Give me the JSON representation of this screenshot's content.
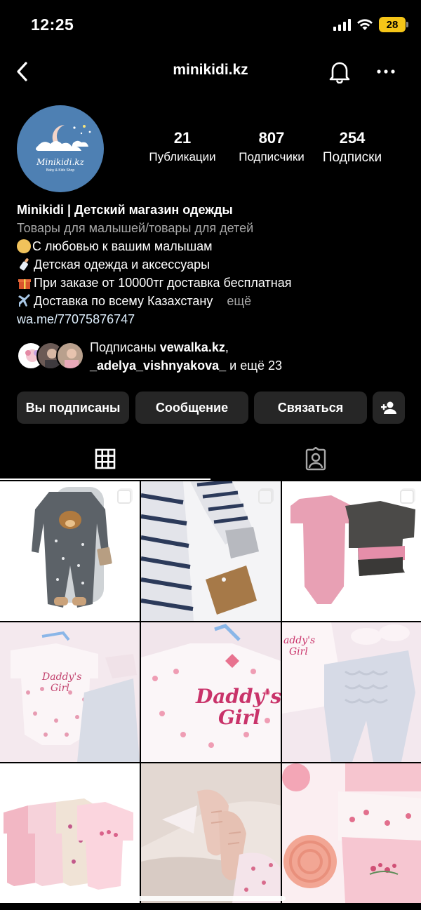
{
  "status_bar": {
    "time": "12:25",
    "battery": "28"
  },
  "nav": {
    "title": "minikidi.kz",
    "back_icon": "chevron-left-icon",
    "bell_icon": "bell-icon",
    "more_icon": "more-horizontal-icon"
  },
  "profile": {
    "avatar_logo": "Minikidi.kz",
    "avatar_sub": "Baby & Kids Shop",
    "stats": [
      {
        "num": "21",
        "label": "Публикации"
      },
      {
        "num": "807",
        "label": "Подписчики"
      },
      {
        "num": "254",
        "label": "Подписки"
      }
    ]
  },
  "bio": {
    "name": "Minikidi | Детский магазин одежды",
    "category": "Товары для малышей/товары для детей",
    "line1": "С любовью к вашим малышам",
    "line2": "Детская одежда и аксессуары",
    "line3": "При заказе от 10000тг доставка бесплатная",
    "line4": "Доставка по всему Казахстану",
    "more": "ещё",
    "link": "wa.me/77075876747"
  },
  "followed_by": {
    "prefix": "Подписаны",
    "user1": "vewalka.kz",
    "user2": "_adelya_vishnyakova_",
    "suffix": "и ещё 23"
  },
  "buttons": {
    "following": "Вы подписаны",
    "message": "Сообщение",
    "contact": "Связаться",
    "add_user_icon": "add-user-icon"
  },
  "tabs": {
    "grid_icon": "grid-icon",
    "tagged_icon": "tagged-person-icon"
  },
  "colors": {
    "background": "#000000",
    "button": "#262626",
    "battery": "#f5c518",
    "avatar": "#4e80b3"
  }
}
